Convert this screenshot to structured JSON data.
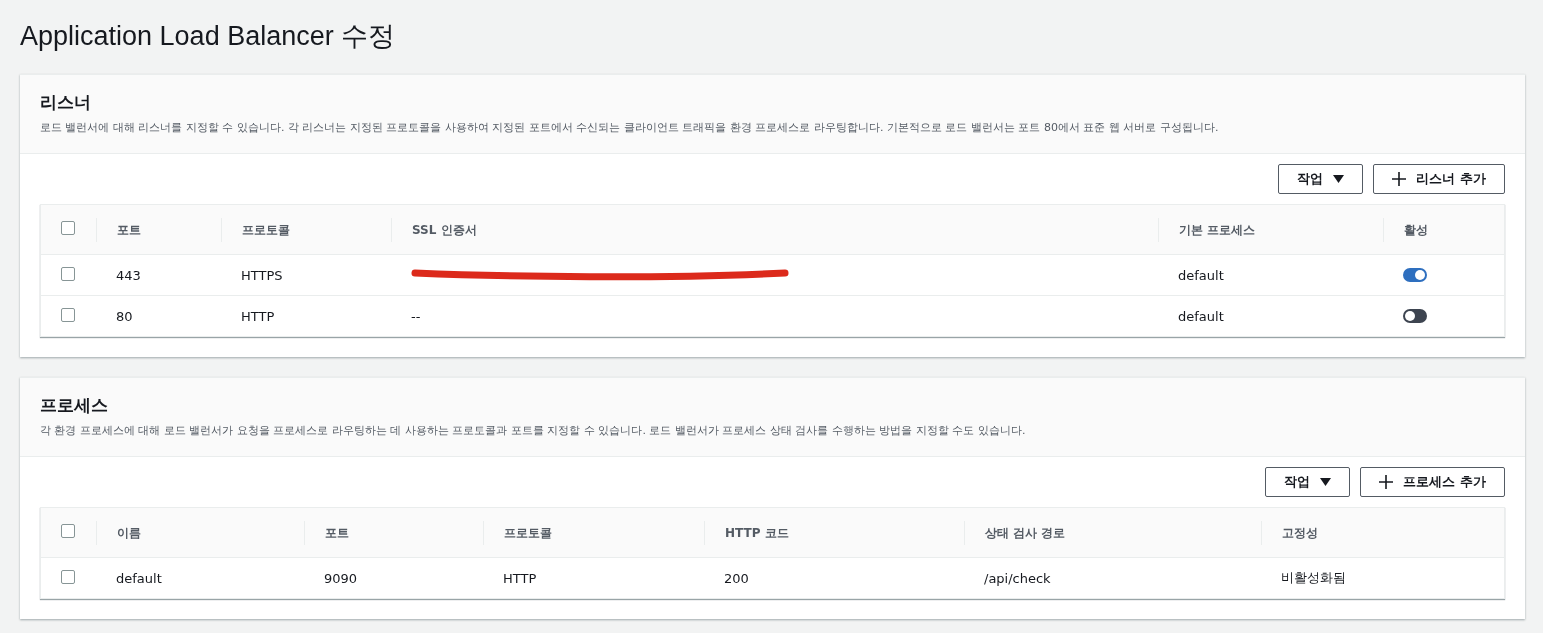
{
  "page_title": "Application Load Balancer 수정",
  "sections": [
    {
      "title": "리스너",
      "description": "로드 밸런서에 대해 리스너를 지정할 수 있습니다. 각 리스너는 지정된 프로토콜을 사용하여 지정된 포트에서 수신되는 클라이언트 트래픽을 환경 프로세스로 라우팅합니다. 기본적으로 로드 밸런서는 포트 80에서 표준 웹 서버로 구성됩니다.",
      "actions_button": "작업",
      "add_button": "리스너 추가",
      "columns": [
        {
          "label": "포트",
          "kind": "text"
        },
        {
          "label": "프로토콜",
          "kind": "text"
        },
        {
          "label": "SSL 인증서",
          "kind": "redactable"
        },
        {
          "label": "기본 프로세스",
          "kind": "text"
        },
        {
          "label": "활성",
          "kind": "toggle"
        }
      ],
      "select_all_checked": false,
      "rows": [
        {
          "checked": false,
          "cells": [
            "443",
            "HTTPS",
            "",
            "default"
          ],
          "redacted": true,
          "on": true
        },
        {
          "checked": false,
          "cells": [
            "80",
            "HTTP",
            "--",
            "default"
          ],
          "redacted": false,
          "on": false
        }
      ]
    },
    {
      "title": "프로세스",
      "description": "각 환경 프로세스에 대해 로드 밸런서가 요청을 프로세스로 라우팅하는 데 사용하는 프로토콜과 포트를 지정할 수 있습니다. 로드 밸런서가 프로세스 상태 검사를 수행하는 방법을 지정할 수도 있습니다.",
      "actions_button": "작업",
      "add_button": "프로세스 추가",
      "columns": [
        {
          "label": "이름",
          "kind": "text"
        },
        {
          "label": "포트",
          "kind": "text"
        },
        {
          "label": "프로토콜",
          "kind": "text"
        },
        {
          "label": "HTTP 코드",
          "kind": "text"
        },
        {
          "label": "상태 검사 경로",
          "kind": "text"
        },
        {
          "label": "고정성",
          "kind": "text"
        }
      ],
      "select_all_checked": false,
      "rows": [
        {
          "checked": false,
          "cells": [
            "default",
            "9090",
            "HTTP",
            "200",
            "/api/check",
            "비활성화됨"
          ]
        }
      ]
    }
  ]
}
